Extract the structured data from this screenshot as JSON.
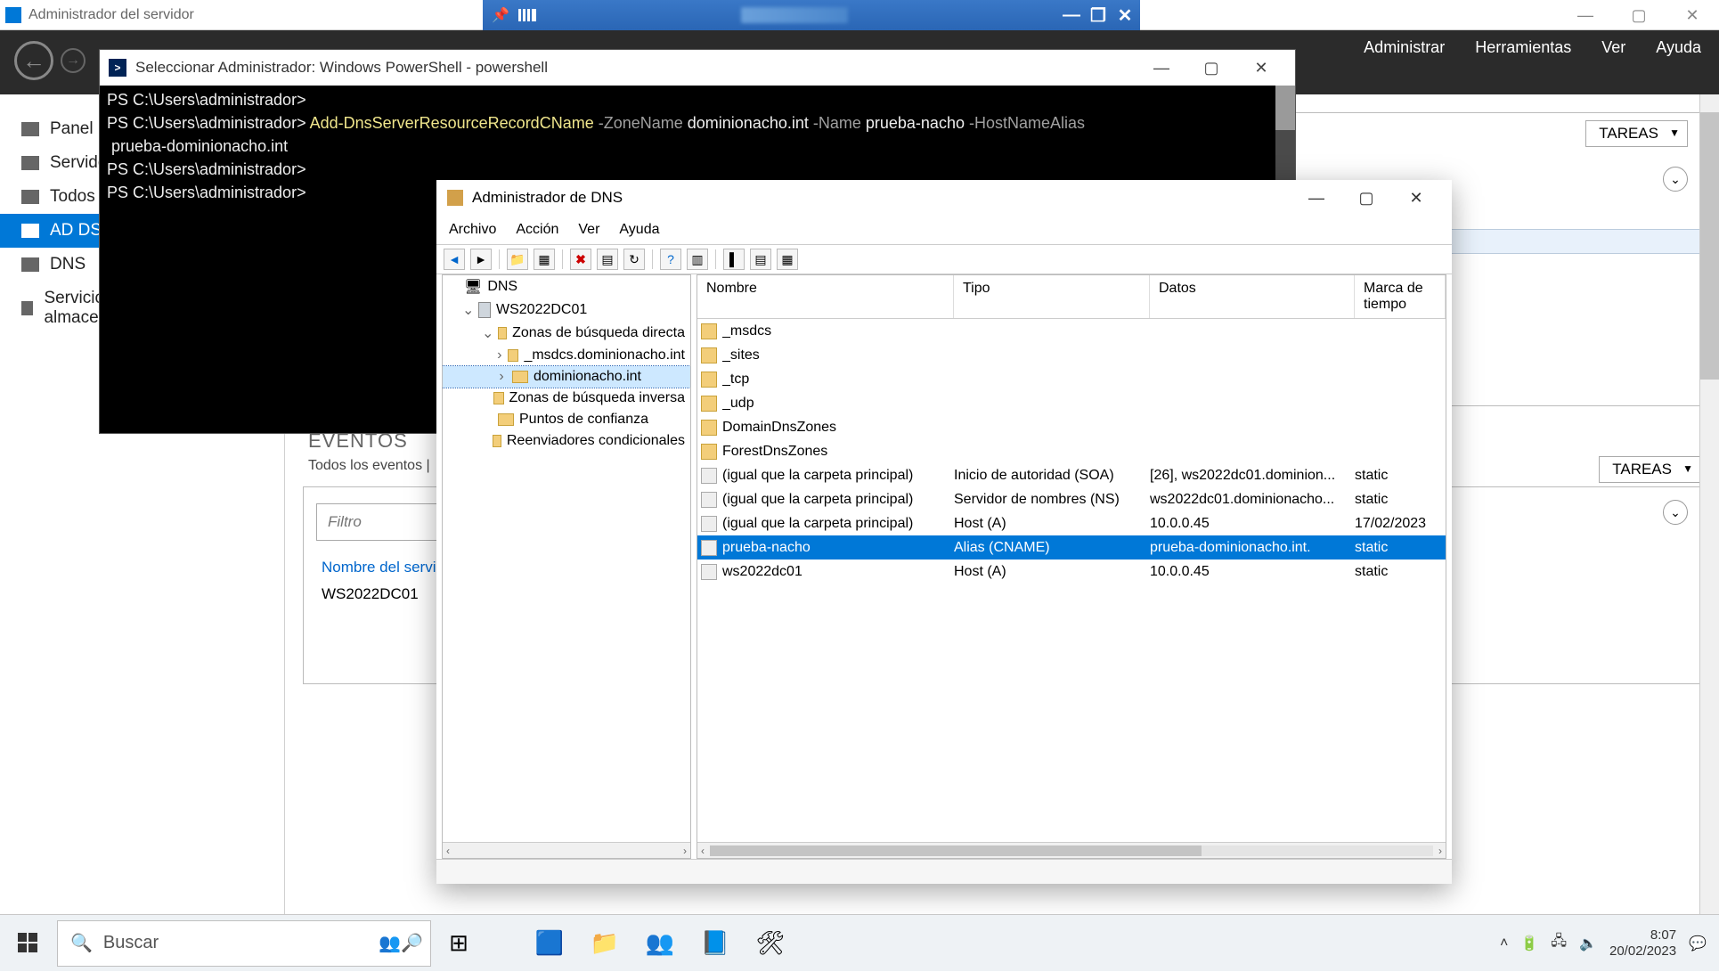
{
  "outer": {
    "title": "Administrador del servidor"
  },
  "vm_bar": {},
  "server_manager": {
    "menus": {
      "administrar": "Administrar",
      "herramientas": "Herramientas",
      "ver": "Ver",
      "ayuda": "Ayuda"
    },
    "sidebar": {
      "items": [
        {
          "label": "Panel"
        },
        {
          "label": "Servidor local"
        },
        {
          "label": "Todos los servidores"
        },
        {
          "label": "AD DS"
        },
        {
          "label": "DNS"
        },
        {
          "label": "Servicios de archivos y de almacenamiento"
        }
      ],
      "selected_index": 3
    },
    "panel1": {
      "tareas": "TAREAS"
    },
    "events": {
      "title": "EVENTOS",
      "subtitle": "Todos los eventos |",
      "filter_placeholder": "Filtro",
      "link": "Nombre del servidor",
      "server": "WS2022DC01",
      "tareas": "TAREAS"
    }
  },
  "powershell": {
    "title": "Seleccionar Administrador: Windows PowerShell - powershell",
    "lines": [
      {
        "prompt": "PS C:\\Users\\administrador>",
        "rest": ""
      },
      {
        "prompt": "PS C:\\Users\\administrador>",
        "cmd": " Add-DnsServerResourceRecordCName",
        "p1": " -ZoneName",
        "v1": " dominionacho.int",
        "p2": " -Name",
        "v2": " prueba-nacho",
        "p3": " -HostNameAlias"
      },
      {
        "cont": " prueba-dominionacho.int"
      },
      {
        "prompt": "PS C:\\Users\\administrador>",
        "rest": ""
      },
      {
        "prompt": "PS C:\\Users\\administrador>",
        "rest": ""
      }
    ]
  },
  "dns": {
    "title": "Administrador de DNS",
    "menus": {
      "archivo": "Archivo",
      "accion": "Acción",
      "ver": "Ver",
      "ayuda": "Ayuda"
    },
    "tree": {
      "root": "DNS",
      "server": "WS2022DC01",
      "zbd": "Zonas de búsqueda directa",
      "z1": "_msdcs.dominionacho.int",
      "z2": "dominionacho.int",
      "zbi": "Zonas de búsqueda inversa",
      "pc": "Puntos de confianza",
      "rc": "Reenviadores condicionales"
    },
    "columns": {
      "nombre": "Nombre",
      "tipo": "Tipo",
      "datos": "Datos",
      "marca": "Marca de tiempo"
    },
    "rows": [
      {
        "icon": "folder",
        "nombre": "_msdcs",
        "tipo": "",
        "datos": "",
        "marca": ""
      },
      {
        "icon": "folder",
        "nombre": "_sites",
        "tipo": "",
        "datos": "",
        "marca": ""
      },
      {
        "icon": "folder",
        "nombre": "_tcp",
        "tipo": "",
        "datos": "",
        "marca": ""
      },
      {
        "icon": "folder",
        "nombre": "_udp",
        "tipo": "",
        "datos": "",
        "marca": ""
      },
      {
        "icon": "folder",
        "nombre": "DomainDnsZones",
        "tipo": "",
        "datos": "",
        "marca": ""
      },
      {
        "icon": "folder",
        "nombre": "ForestDnsZones",
        "tipo": "",
        "datos": "",
        "marca": ""
      },
      {
        "icon": "rec",
        "nombre": "(igual que la carpeta principal)",
        "tipo": "Inicio de autoridad (SOA)",
        "datos": "[26], ws2022dc01.dominion...",
        "marca": "static"
      },
      {
        "icon": "rec",
        "nombre": "(igual que la carpeta principal)",
        "tipo": "Servidor de nombres (NS)",
        "datos": "ws2022dc01.dominionacho...",
        "marca": "static"
      },
      {
        "icon": "rec",
        "nombre": "(igual que la carpeta principal)",
        "tipo": "Host (A)",
        "datos": "10.0.0.45",
        "marca": "17/02/2023"
      },
      {
        "icon": "rec",
        "nombre": "prueba-nacho",
        "tipo": "Alias (CNAME)",
        "datos": "prueba-dominionacho.int.",
        "marca": "static",
        "selected": true
      },
      {
        "icon": "rec",
        "nombre": "ws2022dc01",
        "tipo": "Host (A)",
        "datos": "10.0.0.45",
        "marca": "static"
      }
    ]
  },
  "taskbar": {
    "search_placeholder": "Buscar",
    "time": "8:07",
    "date": "20/02/2023"
  }
}
